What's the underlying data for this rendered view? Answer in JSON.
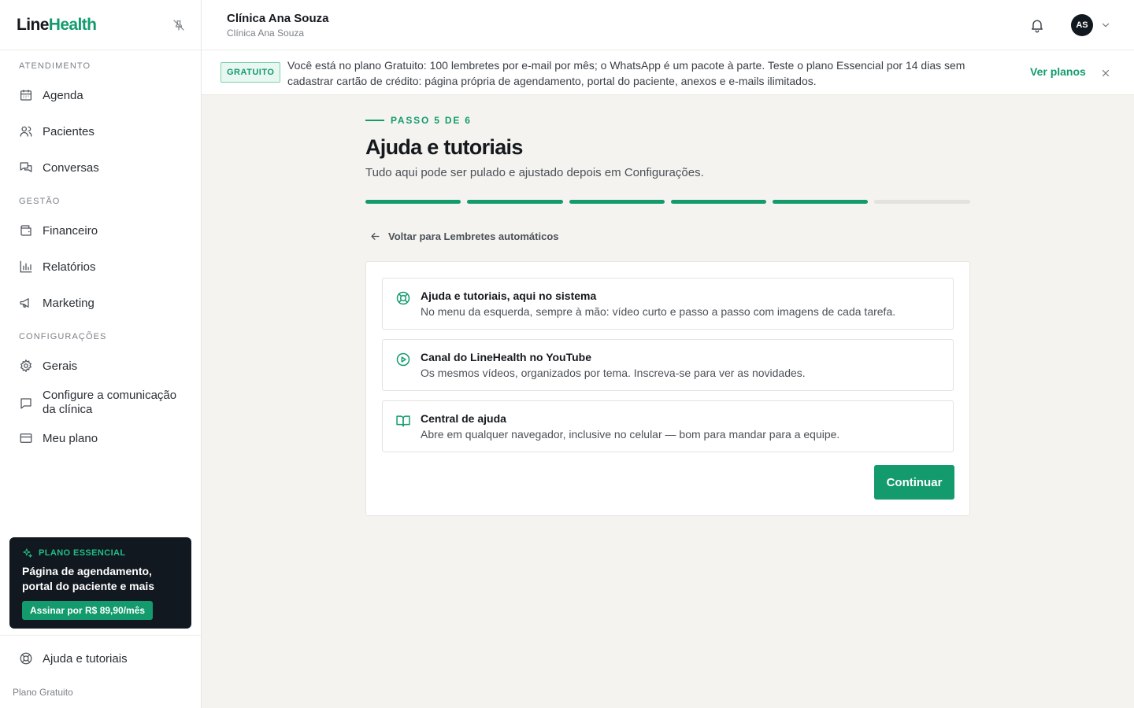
{
  "brand": {
    "name_part1": "Line",
    "name_part2": "Health",
    "accent_color": "#129c6e"
  },
  "sidebar": {
    "sections": [
      {
        "title": "ATENDIMENTO"
      },
      {
        "title": "GESTÃO"
      },
      {
        "title": "CONFIGURAÇÕES"
      }
    ],
    "items": [
      {
        "label": "Agenda",
        "icon": "calendar-icon"
      },
      {
        "label": "Pacientes",
        "icon": "users-icon"
      },
      {
        "label": "Conversas",
        "icon": "chat-bubbles-icon"
      },
      {
        "label": "Financeiro",
        "icon": "wallet-icon"
      },
      {
        "label": "Relatórios",
        "icon": "bar-chart-icon"
      },
      {
        "label": "Marketing",
        "icon": "megaphone-icon"
      },
      {
        "label": "Gerais",
        "icon": "gear-icon"
      },
      {
        "label": "Configure a comunicação da clínica",
        "icon": "message-square-icon"
      },
      {
        "label": "Meu plano",
        "icon": "credit-card-icon"
      }
    ],
    "promo": {
      "tag": "PLANO ESSENCIAL",
      "title": "Página de agendamento, portal do paciente e mais",
      "button": "Assinar por R$ 89,90/mês"
    },
    "help_item": {
      "label": "Ajuda e tutoriais",
      "icon": "lifebuoy-icon"
    },
    "plan_footer": "Plano Gratuito"
  },
  "topbar": {
    "clinic_name": "Clínica Ana Souza",
    "clinic_sub": "Clínica Ana Souza",
    "avatar_initials": "AS"
  },
  "banner": {
    "badge": "GRATUITO",
    "text": "Você está no plano Gratuito: 100 lembretes por e-mail por mês; o WhatsApp é um pacote à parte. Teste o plano Essencial por 14 dias sem cadastrar cartão de crédito: página própria de agendamento, portal do paciente, anexos e e-mails ilimitados.",
    "link": "Ver planos"
  },
  "wizard": {
    "step_label": "PASSO 5 DE 6",
    "step_current": 5,
    "step_total": 6,
    "title": "Ajuda e tutoriais",
    "subtitle": "Tudo aqui pode ser pulado e ajustado depois em Configurações.",
    "back_link": "Voltar para Lembretes automáticos",
    "options": [
      {
        "title": "Ajuda e tutoriais, aqui no sistema",
        "desc": "No menu da esquerda, sempre à mão: vídeo curto e passo a passo com imagens de cada tarefa.",
        "icon": "lifebuoy-icon"
      },
      {
        "title": "Canal do LineHealth no YouTube",
        "desc": "Os mesmos vídeos, organizados por tema. Inscreva-se para ver as novidades.",
        "icon": "play-circle-icon"
      },
      {
        "title": "Central de ajuda",
        "desc": "Abre em qualquer navegador, inclusive no celular — bom para mandar para a equipe.",
        "icon": "book-open-icon"
      }
    ],
    "continue_button": "Continuar"
  }
}
